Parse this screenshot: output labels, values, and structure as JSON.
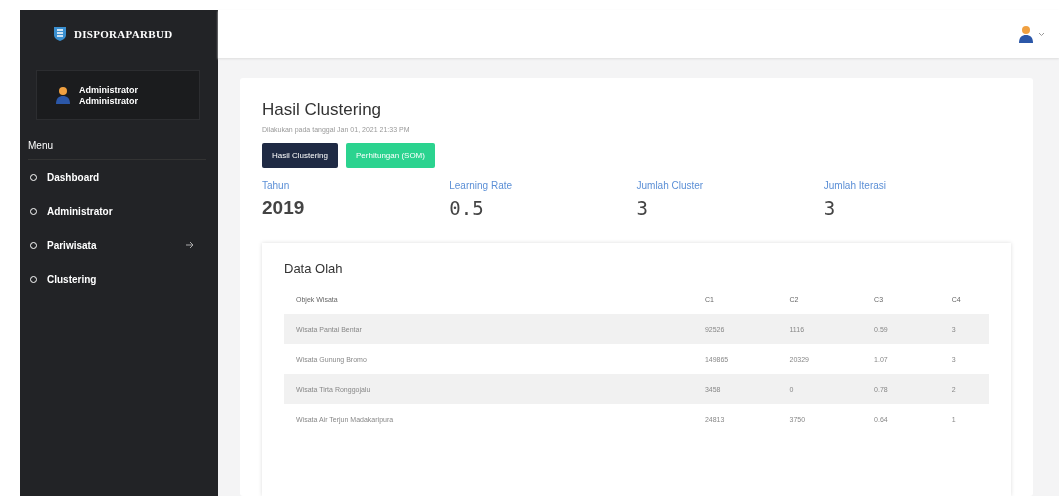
{
  "brand": {
    "name": "DISPORAPARBUD"
  },
  "user": {
    "name": "Administrator",
    "role": "Administrator"
  },
  "menu_title": "Menu",
  "menu_items": [
    {
      "label": "Dashboard",
      "has_submenu": false
    },
    {
      "label": "Administrator",
      "has_submenu": false
    },
    {
      "label": "Pariwisata",
      "has_submenu": true
    },
    {
      "label": "Clustering",
      "has_submenu": false
    }
  ],
  "page": {
    "title": "Hasil Clustering",
    "subtitle": "Dilakukan pada tanggal Jan 01, 2021 21:33 PM"
  },
  "tabs": [
    {
      "label": "Hasil Clustering",
      "selected": true
    },
    {
      "label": "Perhitungan (SOM)",
      "selected": false
    }
  ],
  "stats": [
    {
      "label": "Tahun",
      "value": "2019",
      "kind": "year"
    },
    {
      "label": "Learning Rate",
      "value": "0.5",
      "kind": "mono"
    },
    {
      "label": "Jumlah Cluster",
      "value": "3",
      "kind": "mono"
    },
    {
      "label": "Jumlah Iterasi",
      "value": "3",
      "kind": "mono"
    }
  ],
  "table": {
    "title": "Data Olah",
    "columns": [
      "Objek Wisata",
      "C1",
      "C2",
      "C3",
      "C4"
    ],
    "rows": [
      [
        "Wisata Pantai Bentar",
        "92526",
        "1116",
        "0.59",
        "3"
      ],
      [
        "Wisata Gunung Bromo",
        "149865",
        "20329",
        "1.07",
        "3"
      ],
      [
        "Wisata Tirta Ronggojalu",
        "3458",
        "0",
        "0.78",
        "2"
      ],
      [
        "Wisata Air Terjun Madakaripura",
        "24813",
        "3750",
        "0.64",
        "1"
      ]
    ]
  }
}
